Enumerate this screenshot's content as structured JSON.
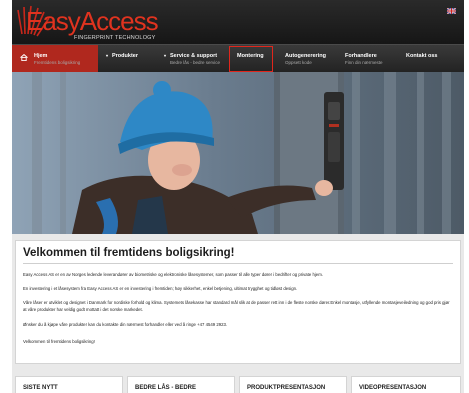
{
  "header": {
    "logo_text": "EasyAccess",
    "logo_tagline": "FINGERPRINT TECHNOLOGY",
    "flag_icon": "uk-flag-icon"
  },
  "nav": {
    "items": [
      {
        "label": "Hjem",
        "sub": "Fremtidens boligsikring",
        "icon": "home-icon"
      },
      {
        "label": "Produkter",
        "sub": "",
        "icon": "caret-down-icon"
      },
      {
        "label": "Service & support",
        "sub": "Bedre lås - bedre service",
        "icon": "caret-down-icon"
      },
      {
        "label": "Montering",
        "sub": ""
      },
      {
        "label": "Autogenerering",
        "sub": "Oppsett kode"
      },
      {
        "label": "Forhandlere",
        "sub": "Finn din nærmeste"
      },
      {
        "label": "Kontakt oss",
        "sub": ""
      }
    ],
    "highlighted": "Montering"
  },
  "welcome": {
    "title": "Velkommen til fremtidens boligsikring!",
    "paragraphs": [
      "Easy Access AS er en av Norges ledende leverandører av biometriske og elektroniske låsesystemer, som passer til alle typer dører i bedrifter og private hjem.",
      "En investering i et låsesystem fra Easy Access AS er en investering i fremtiden; høy sikkerhet, enkel betjening, ultimat trygghet og tidløst design.",
      "Våre låser er utviklet og designet i Danmark for nordiske forhold og klima. Systemets låsekasse har standard mål slik at de passer rett inn i de fleste norske dører.Enkel montasje, utfyllende montasjeveiledning og god pris gjør at våre produkter har veldig godt mottatt i det norske markedet.",
      "Ønsker du å kjøpe våre produkter kan du kontakte din nærmest forhandler eller ved å ringe +47 4549 2923.",
      "Velkommen til fremtidens boligsikring!"
    ]
  },
  "boxes": [
    "SISTE NYTT",
    "BEDRE LÅS - BEDRE",
    "PRODUKTPRESENTASJON",
    "VIDEOPRESENTASJON"
  ],
  "colors": {
    "accent": "#b0281e",
    "logo": "#e0331f",
    "highlight": "#e0261c"
  }
}
